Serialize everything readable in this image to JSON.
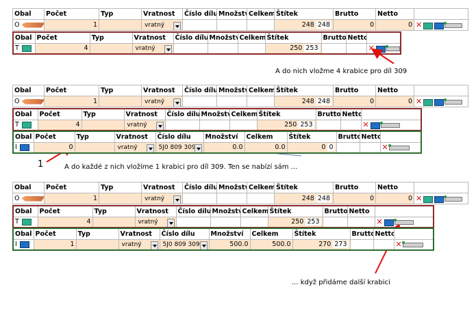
{
  "headers": [
    "Obal",
    "Počet",
    "Typ",
    "Vratnost",
    "Číslo dílu",
    "Množství",
    "Celkem",
    "Štítek",
    "Brutto",
    "Netto"
  ],
  "vratnost": "vratný",
  "b1": {
    "r1": {
      "code": "O",
      "pocet": "1",
      "stitek": "248",
      "stitek2": "248",
      "brutto": "0",
      "netto": "0"
    },
    "r2": {
      "code": "T",
      "pocet": "4",
      "stitek": "250",
      "stitek2": "253"
    }
  },
  "annotation1": "A do nich vložme 4 krabice pro díl 309",
  "b2": {
    "r1": {
      "code": "O",
      "pocet": "1",
      "stitek": "248",
      "stitek2": "248",
      "brutto": "0",
      "netto": "0"
    },
    "r2": {
      "code": "T",
      "pocet": "4",
      "stitek": "250",
      "stitek2": "253"
    },
    "r3": {
      "code": "I",
      "pocet": "0",
      "cislo": "5J0 809 309",
      "mnozstvi": "0.0",
      "celkem": "0.0",
      "stitek": "0",
      "stitek2": "0"
    }
  },
  "num_label": "1",
  "annotation2": "A do každé z nich vložíme 1 krabici pro díl 309. Ten se nabízí sám ...",
  "b3": {
    "r1": {
      "code": "O",
      "pocet": "1",
      "stitek": "248",
      "stitek2": "248",
      "brutto": "0",
      "netto": "0"
    },
    "r2": {
      "code": "T",
      "pocet": "4",
      "stitek": "250",
      "stitek2": "253"
    },
    "r3": {
      "code": "I",
      "pocet": "1",
      "cislo": "5J0 809 309",
      "mnozstvi": "500.0",
      "celkem": "500.0",
      "stitek": "270",
      "stitek2": "273"
    }
  },
  "annotation3": "... když přidáme další krabici",
  "colors": {
    "peach": "#fde5cc",
    "arrow": "#e01010",
    "level2_border": "#8b2a2a",
    "level3_border": "#2f6b2f"
  },
  "icons": [
    "delete-x-icon",
    "pallet-icon",
    "box-icon",
    "label-slider-icon"
  ]
}
